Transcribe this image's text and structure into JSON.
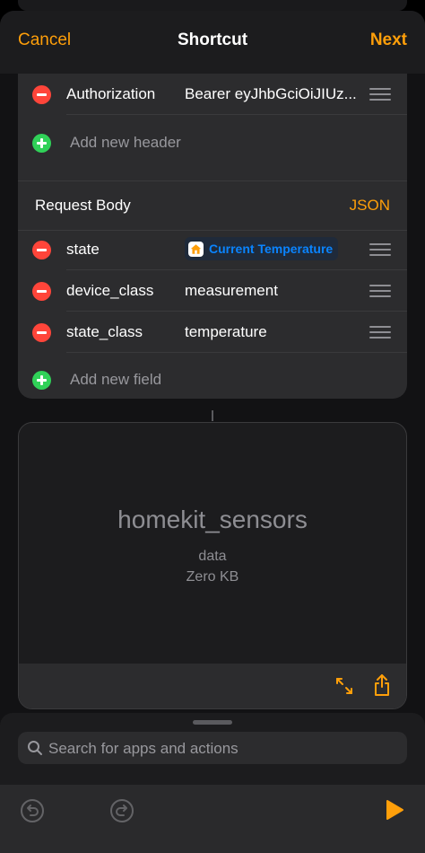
{
  "nav": {
    "cancel": "Cancel",
    "title": "Shortcut",
    "next": "Next"
  },
  "headers": {
    "rows": [
      {
        "key": "Authorization",
        "value": "Bearer eyJhbGciOiJIUz..."
      }
    ],
    "add_label": "Add new header"
  },
  "request_body": {
    "title": "Request Body",
    "type": "JSON",
    "fields": [
      {
        "key": "state",
        "token": "Current Temperature"
      },
      {
        "key": "device_class",
        "value": "measurement"
      },
      {
        "key": "state_class",
        "value": "temperature"
      }
    ],
    "add_label": "Add new field"
  },
  "preview": {
    "name": "homekit_sensors",
    "type": "data",
    "size": "Zero KB"
  },
  "search": {
    "placeholder": "Search for apps and actions"
  },
  "icons": {
    "remove": "minus-circle-icon",
    "add": "plus-circle-icon",
    "home": "home-icon",
    "expand": "expand-arrows-icon",
    "share": "share-icon",
    "undo": "undo-icon",
    "redo": "redo-icon",
    "run": "play-icon",
    "search": "search-icon"
  },
  "colors": {
    "accent": "#ff9f0a",
    "remove": "#ff453a",
    "add": "#30d158",
    "token_text": "#0a84ff"
  }
}
